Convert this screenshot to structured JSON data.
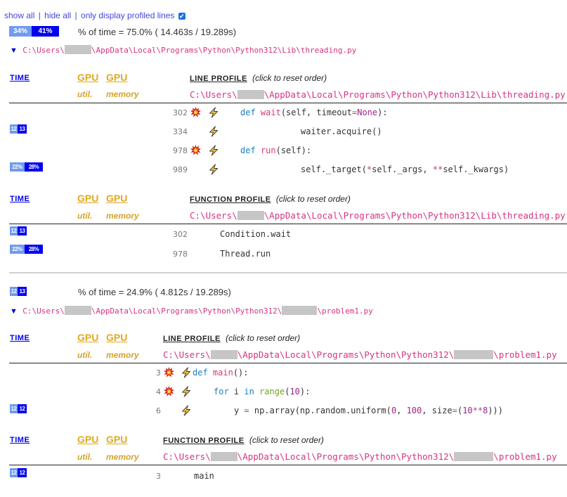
{
  "toolbar": {
    "show_all": "show all",
    "hide_all": "hide all",
    "only_profiled": "only display profiled lines",
    "separator": "|",
    "only_profiled_checked": true
  },
  "colors": {
    "bar_python": "#6f9aef",
    "bar_native": "#0000ee",
    "path": "#d63384",
    "gpu_header": "#e0a922",
    "link": "#0000ee"
  },
  "files": [
    {
      "summary_bar": {
        "python": "34%",
        "native": "41%"
      },
      "percent_text": "% of time =  75.0% ( 14.463s /  19.289s)",
      "path_prefix": "C:\\Users\\",
      "path_middle": "\\AppData\\Local\\Programs\\Python\\Python312\\Lib\\threading.py",
      "path_suffix": "",
      "line_profile": {
        "headers": {
          "time": "TIME",
          "gpu1": "GPU",
          "gpu2": "GPU",
          "util": "util.",
          "memory": "memory",
          "title": "LINE PROFILE",
          "hint": "(click to reset order)"
        },
        "rows": [
          {
            "bar": null,
            "lineno": "302",
            "boom": true,
            "bolt": true,
            "code": "def wait(self, timeout=None):"
          },
          {
            "bar": {
              "python": "12",
              "native": "13"
            },
            "lineno": "334",
            "boom": false,
            "bolt": true,
            "code": "waiter.acquire()"
          },
          {
            "bar": null,
            "lineno": "978",
            "boom": true,
            "bolt": true,
            "code": "def run(self):"
          },
          {
            "bar": {
              "python": "22%",
              "native": "28%"
            },
            "lineno": "989",
            "boom": false,
            "bolt": true,
            "code": "self._target(*self._args, **self._kwargs)"
          }
        ]
      },
      "function_profile": {
        "headers": {
          "time": "TIME",
          "gpu1": "GPU",
          "gpu2": "GPU",
          "util": "util.",
          "memory": "memory",
          "title": "FUNCTION PROFILE",
          "hint": "(click to reset order)"
        },
        "rows": [
          {
            "bar": {
              "python": "12",
              "native": "13"
            },
            "lineno": "302",
            "name": "Condition.wait"
          },
          {
            "bar": {
              "python": "22%",
              "native": "28%"
            },
            "lineno": "978",
            "name": "Thread.run"
          }
        ]
      }
    },
    {
      "summary_bar": {
        "python": "12",
        "native": "13"
      },
      "percent_text": "% of time =  24.9% (  4.812s /  19.289s)",
      "path_prefix": "C:\\Users\\",
      "path_middle": "\\AppData\\Local\\Programs\\Python\\Python312\\",
      "path_suffix": "\\problem1.py",
      "line_profile": {
        "headers": {
          "time": "TIME",
          "gpu1": "GPU",
          "gpu2": "GPU",
          "util": "util.",
          "memory": "memory",
          "title": "LINE PROFILE",
          "hint": "(click to reset order)"
        },
        "rows": [
          {
            "bar": null,
            "lineno": "3",
            "boom": true,
            "bolt": true,
            "code": "def main():"
          },
          {
            "bar": null,
            "lineno": "4",
            "boom": true,
            "bolt": true,
            "code": "for i in range(10):"
          },
          {
            "bar": {
              "python": "12",
              "native": "12"
            },
            "lineno": "6",
            "boom": false,
            "bolt": true,
            "code": "y = np.array(np.random.uniform(0, 100, size=(10**8)))"
          }
        ]
      },
      "function_profile": {
        "headers": {
          "time": "TIME",
          "gpu1": "GPU",
          "gpu2": "GPU",
          "util": "util.",
          "memory": "memory",
          "title": "FUNCTION PROFILE",
          "hint": "(click to reset order)"
        },
        "rows": [
          {
            "bar": {
              "python": "12",
              "native": "12"
            },
            "lineno": "3",
            "name": "main"
          }
        ]
      }
    }
  ]
}
